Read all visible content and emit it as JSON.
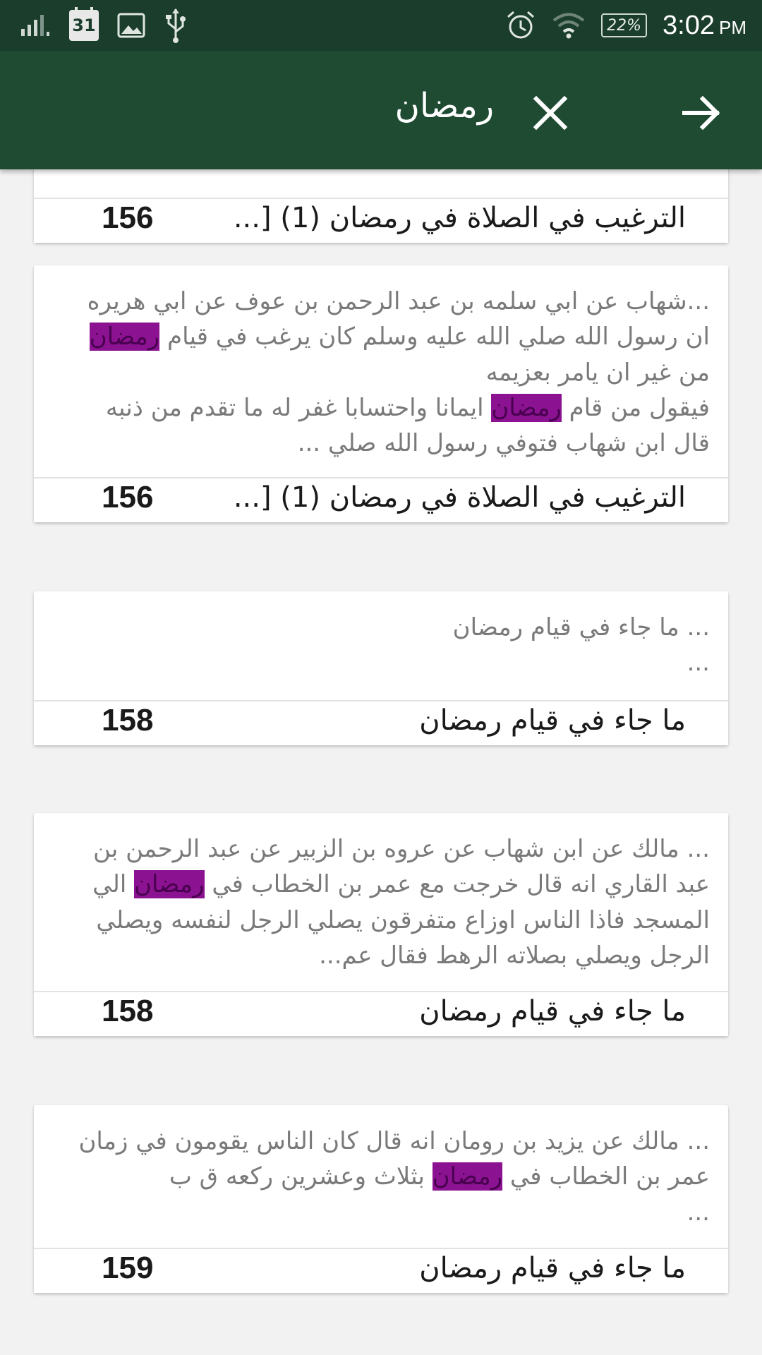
{
  "status_bar": {
    "calendar_day": "31",
    "battery": "22%",
    "time": "3:02",
    "ampm": "PM",
    "icons": [
      "signal-icon",
      "calendar-icon",
      "image-icon",
      "usb-icon",
      "alarm-icon",
      "wifi-icon",
      "battery-icon"
    ]
  },
  "app_bar": {
    "search_query": "رمضان",
    "close_icon": "close-icon",
    "forward_icon": "arrow-forward-icon",
    "background": "#1f4b33"
  },
  "highlight_color": "#8b1391",
  "results": [
    {
      "title": "الترغيب في الصلاة في رمضان (1) [...",
      "page": "156"
    },
    {
      "snippet_lines": [
        [
          "...شهاب عن ابي سلمه بن  عبد الرحمن بن عوف عن ابي هريره"
        ],
        [
          "ان رسول الله صلي الله عليه وسلم كان يرغب في قيام ",
          {
            "hl": "رمضان"
          }
        ],
        [
          "من غير ان يامر بعزيمه"
        ],
        [
          "فيقول من قام ",
          {
            "hl": "رمضان"
          },
          " ايمانا واحتسابا غفر له ما تقدم من ذنبه"
        ],
        [
          "قال ابن شهاب فتوفي رسول الله صلي ..."
        ]
      ],
      "title": "الترغيب في الصلاة في رمضان (1) [...",
      "page": "156"
    },
    {
      "snippet_lines": [
        [
          "...  ما جاء في قيام رمضان"
        ],
        [
          "..."
        ]
      ],
      "title": "ما جاء في قيام رمضان",
      "page": "158"
    },
    {
      "snippet_lines": [
        [
          "...  مالك عن ابن شهاب عن عروه بن الزبير عن عبد الرحمن بن"
        ],
        [
          "عبد القاري انه قال خرجت مع عمر بن الخطاب في ",
          {
            "hl": "رمضان"
          },
          " الي"
        ],
        [
          "المسجد فاذا الناس اوزاع متفرقون    يصلي الرجل لنفسه ويصلي"
        ],
        [
          "الرجل ويصلي    بصلاته الرهط    فقال عم..."
        ]
      ],
      "title": "ما جاء في قيام رمضان",
      "page": "158"
    },
    {
      "snippet_lines": [
        [
          "...  مالك عن يزيد بن رومان انه قال كان الناس يقومون في زمان"
        ],
        [
          "عمر بن الخطاب في ",
          {
            "hl": "رمضان"
          },
          " بثلاث وعشرين ركعه ق   ب"
        ],
        [
          "..."
        ]
      ],
      "title": "ما جاء في قيام رمضان",
      "page": "159"
    }
  ]
}
